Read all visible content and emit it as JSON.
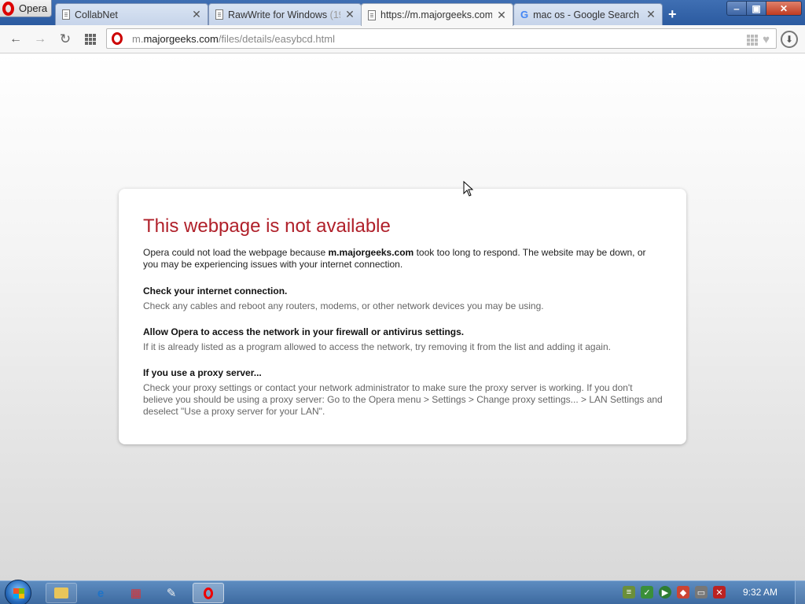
{
  "browser": {
    "menu_label": "Opera",
    "new_tab_symbol": "+",
    "tabs": [
      {
        "title": "CollabNet",
        "title_dim": "",
        "icon": "page-icon"
      },
      {
        "title": "RawWrite for Windows ",
        "title_dim": "(19",
        "icon": "page-icon"
      },
      {
        "title": "https://m.majorgeeks.com",
        "title_dim": "",
        "icon": "page-icon"
      },
      {
        "title": "mac os - Google Search",
        "title_dim": "",
        "icon": "google-icon"
      }
    ],
    "tab_close_symbol": "✕",
    "window_controls": {
      "minimize": "‒",
      "maximize": "▣",
      "close": "✕"
    }
  },
  "toolbar": {
    "back": "←",
    "forward": "→",
    "reload": "↻",
    "address": {
      "prefix": "m.",
      "host": "majorgeeks.com",
      "path": "/files/details/easybcd.html"
    },
    "heart": "♥",
    "download": "⬇"
  },
  "error_page": {
    "title": "This webpage is not available",
    "intro_pre": "Opera could not load the webpage because ",
    "intro_host": "m.majorgeeks.com",
    "intro_post": " took too long to respond. The website may be down, or you may be experiencing issues with your internet connection.",
    "sections": [
      {
        "heading": "Check your internet connection.",
        "body": "Check any cables and reboot any routers, modems, or other network devices you may be using."
      },
      {
        "heading": "Allow Opera to access the network in your firewall or antivirus settings.",
        "body": "If it is already listed as a program allowed to access the network, try removing it from the list and adding it again."
      },
      {
        "heading": "If you use a proxy server...",
        "body": "Check your proxy settings or contact your network administrator to make sure the proxy server is working. If you don't believe you should be using a proxy server: Go to the Opera menu > Settings > Change proxy settings... > LAN Settings and deselect \"Use a proxy server for your LAN\"."
      }
    ],
    "title_color": "#b0202a"
  },
  "taskbar": {
    "pinned": [
      "explorer-icon",
      "internet-explorer-icon",
      "app-icon",
      "app-icon",
      "opera-icon"
    ],
    "ie_glyph": "e",
    "tray": [
      "network-icon",
      "security-icon",
      "media-icon",
      "app-tray-icon",
      "display-icon",
      "volume-muted-icon"
    ],
    "clock": "9:32 AM"
  }
}
